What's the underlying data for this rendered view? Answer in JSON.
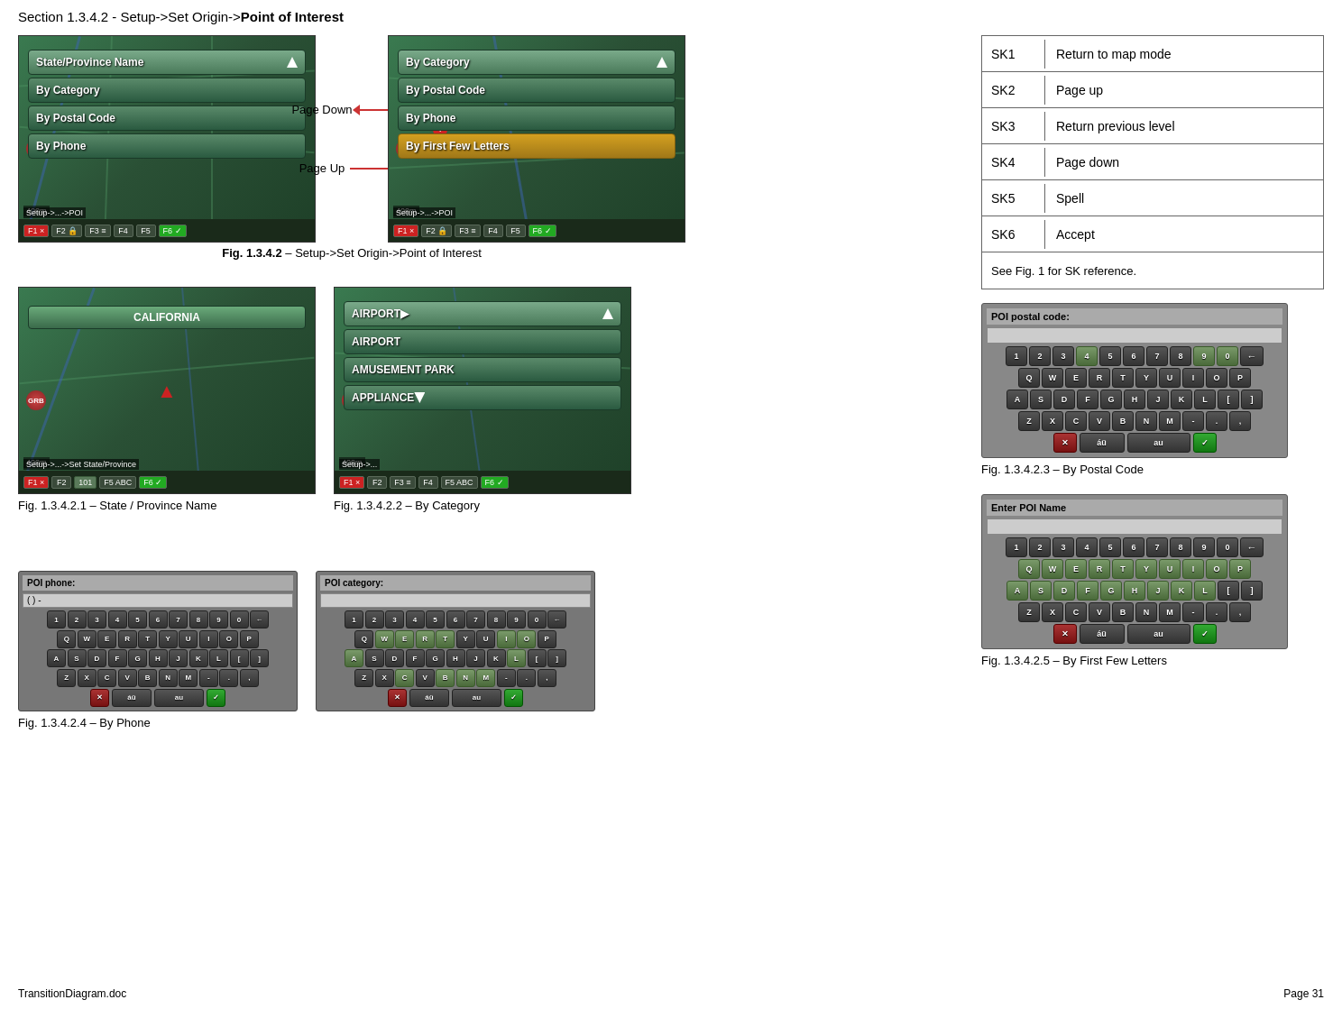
{
  "title": {
    "section": "Section 1.3.4.2",
    "subtitle": " - Setup->Set Origin->",
    "bold": "Point of Interest"
  },
  "top_section": {
    "page_down_label": "Page Down",
    "page_up_label": "Page Up",
    "fig_caption": {
      "num": "Fig. 1.3.4.2",
      "text": " – Setup->Set Origin->Point of Interest"
    }
  },
  "screenshot1": {
    "menu_items": [
      {
        "label": "State/Province Name",
        "type": "header"
      },
      {
        "label": "By Category",
        "type": "normal"
      },
      {
        "label": "By Postal Code",
        "type": "normal"
      },
      {
        "label": "By Phone",
        "type": "normal"
      }
    ],
    "breadcrumb": "Setup->...->POI",
    "toolbar": [
      "F1",
      "F2",
      "F3",
      "F4",
      "F5",
      "F6"
    ]
  },
  "screenshot2": {
    "menu_items": [
      {
        "label": "By Category",
        "type": "header"
      },
      {
        "label": "By Postal Code",
        "type": "normal"
      },
      {
        "label": "By Phone",
        "type": "normal"
      },
      {
        "label": "By First Few Letters",
        "type": "highlighted"
      }
    ],
    "breadcrumb": "Setup->...->POI",
    "toolbar": [
      "F1",
      "F2",
      "F3",
      "F4",
      "F5",
      "F6"
    ]
  },
  "sk_table": {
    "rows": [
      {
        "key": "SK1",
        "value": "Return to map mode"
      },
      {
        "key": "SK2",
        "value": "Page up"
      },
      {
        "key": "SK3",
        "value": "Return previous level"
      },
      {
        "key": "SK4",
        "value": "Page down"
      },
      {
        "key": "SK5",
        "value": "Spell"
      },
      {
        "key": "SK6",
        "value": "Accept"
      }
    ],
    "note": "See Fig. 1 for SK reference."
  },
  "screenshot_state": {
    "label": "CALIFORNIA",
    "breadcrumb": "Setup->...->Set State/Province",
    "toolbar": [
      "F1",
      "F2",
      "101",
      "F5 ABC",
      "F6"
    ],
    "fig_num": "Fig. 1.3.4.2.1",
    "fig_text": " – State / Province Name"
  },
  "screenshot_category": {
    "menu_items": [
      {
        "label": "AIRPORT",
        "type": "header_highlight"
      },
      {
        "label": "AIRPORT",
        "type": "normal"
      },
      {
        "label": "AMUSEMENT PARK",
        "type": "normal"
      },
      {
        "label": "APPLIANCE",
        "type": "normal"
      }
    ],
    "breadcrumb": "Setup->...",
    "toolbar": [
      "F1",
      "F2",
      "F3",
      "F4",
      "F5 ABC",
      "F6"
    ],
    "fig_num": "Fig. 1.3.4.2.2",
    "fig_text": " – By Category"
  },
  "poi_postal_kb": {
    "title": "POI postal code:",
    "input": "",
    "rows": [
      [
        "1",
        "2",
        "3",
        "4",
        "5",
        "6",
        "7",
        "8",
        "9",
        "0",
        "←"
      ],
      [
        "Q",
        "W",
        "E",
        "R",
        "T",
        "Y",
        "U",
        "I",
        "O",
        "P"
      ],
      [
        "A",
        "S",
        "D",
        "F",
        "G",
        "H",
        "J",
        "K",
        "L",
        "[",
        "]"
      ],
      [
        "Z",
        "X",
        "C",
        "V",
        "B",
        "N",
        "M",
        "-",
        ".",
        ","
      ]
    ],
    "highlighted_keys": [
      "4",
      "9",
      "0"
    ],
    "bottom": [
      "×",
      "áü",
      "au",
      "✓"
    ],
    "fig_num": "Fig. 1.3.4.2.3",
    "fig_text": " – By Postal Code"
  },
  "poi_phone_kb": {
    "title": "POI phone:",
    "input": "( )  -",
    "rows": [
      [
        "1",
        "2",
        "3",
        "4",
        "5",
        "6",
        "7",
        "8",
        "9",
        "0",
        "←"
      ],
      [
        "Q",
        "W",
        "E",
        "R",
        "T",
        "Y",
        "U",
        "I",
        "O",
        "P"
      ],
      [
        "A",
        "S",
        "D",
        "F",
        "G",
        "H",
        "J",
        "K",
        "L",
        "[",
        "]"
      ],
      [
        "Z",
        "X",
        "C",
        "V",
        "B",
        "N",
        "M",
        "-",
        ".",
        ","
      ]
    ],
    "fig_num": "Fig. 1.3.4.2.4",
    "fig_text": " – By Phone"
  },
  "poi_category_kb": {
    "title": "POI category:",
    "input": "",
    "rows": [
      [
        "1",
        "2",
        "3",
        "4",
        "5",
        "6",
        "7",
        "8",
        "9",
        "0",
        "←"
      ],
      [
        "Q",
        "W",
        "E",
        "R",
        "T",
        "Y",
        "U",
        "I",
        "O",
        "P"
      ],
      [
        "A",
        "S",
        "D",
        "F",
        "G",
        "H",
        "J",
        "K",
        "L",
        "[",
        "]"
      ],
      [
        "Z",
        "X",
        "C",
        "V",
        "B",
        "N",
        "M",
        "-",
        ".",
        ","
      ]
    ],
    "highlighted_keys": [
      "W",
      "E",
      "R",
      "T",
      "I",
      "O",
      "A",
      "C",
      "B",
      "N",
      "M",
      "L"
    ],
    "bottom": [
      "×",
      "áü",
      "au",
      "✓"
    ]
  },
  "poi_name_kb": {
    "title": "Enter POI Name",
    "input": "",
    "rows": [
      [
        "1",
        "2",
        "3",
        "4",
        "5",
        "6",
        "7",
        "8",
        "9",
        "0",
        "←"
      ],
      [
        "Q",
        "W",
        "E",
        "R",
        "T",
        "Y",
        "U",
        "I",
        "O",
        "P"
      ],
      [
        "A",
        "S",
        "D",
        "F",
        "G",
        "H",
        "J",
        "K",
        "L",
        "[",
        "]"
      ],
      [
        "Z",
        "X",
        "C",
        "V",
        "B",
        "N",
        "M",
        "-",
        ".",
        ","
      ]
    ],
    "highlighted_keys": [
      "Q",
      "W",
      "E",
      "R",
      "T",
      "Y",
      "U",
      "I",
      "O",
      "P",
      "A",
      "S",
      "D",
      "F",
      "G",
      "H",
      "J",
      "K",
      "L"
    ],
    "bottom": [
      "×",
      "áü",
      "au",
      "✓"
    ],
    "fig_num": "Fig. 1.3.4.2.5",
    "fig_text": " – By First Few Letters"
  },
  "footer": {
    "left": "TransitionDiagram.doc",
    "right": "Page 31"
  }
}
